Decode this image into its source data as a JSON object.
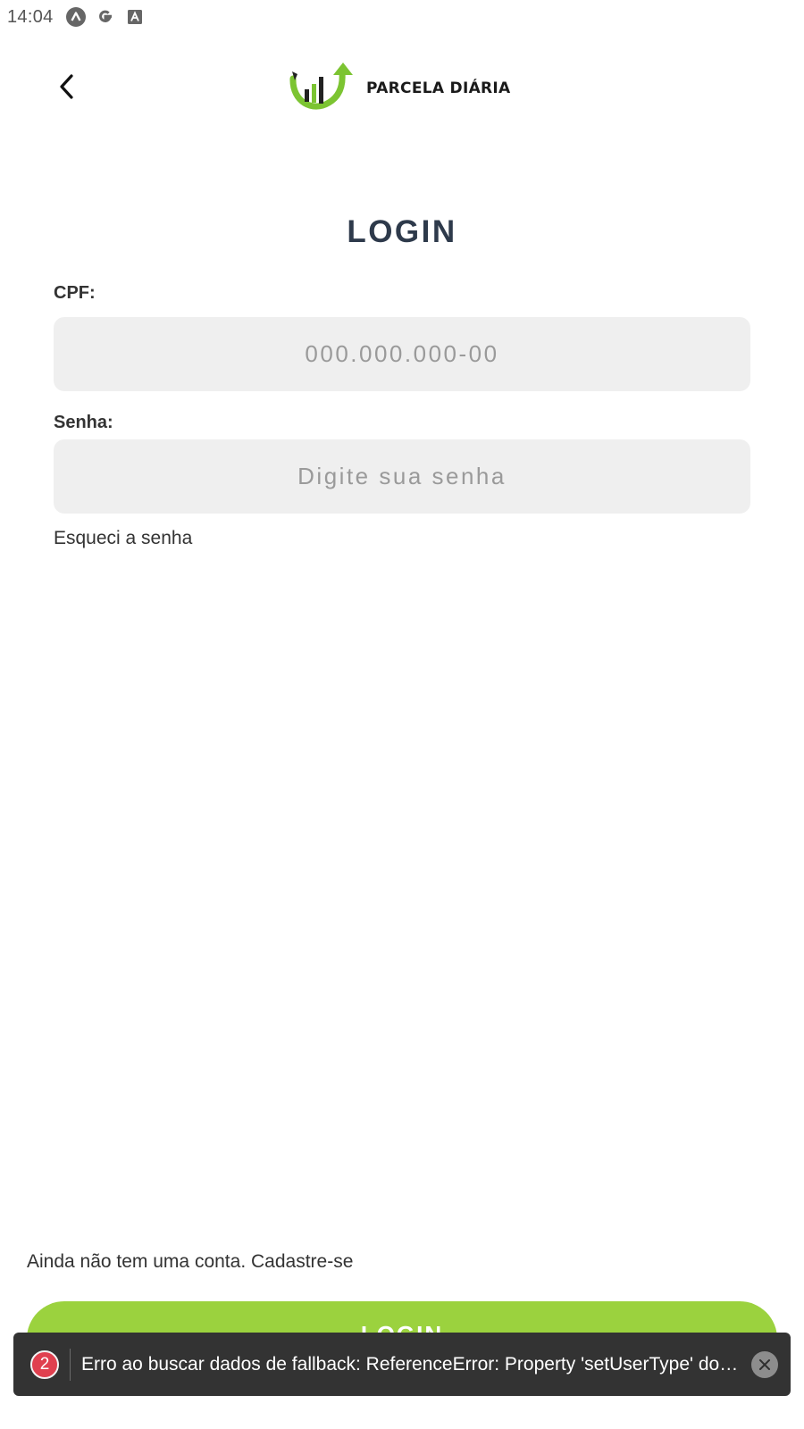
{
  "status_bar": {
    "time": "14:04",
    "icons": [
      "a-logo-icon",
      "google-icon",
      "text-box-icon"
    ]
  },
  "header": {
    "back_icon": "chevron-left-icon",
    "logo_text": "PARCELA DIÁRIA"
  },
  "title": "LOGIN",
  "form": {
    "cpf_label": "CPF:",
    "cpf_placeholder": "000.000.000-00",
    "cpf_value": "",
    "password_label": "Senha:",
    "password_placeholder": "Digite sua senha",
    "password_value": "",
    "forgot_password": "Esqueci a senha"
  },
  "signup_text": "Ainda não tem uma conta. Cadastre-se",
  "login_button": "LOGIN",
  "toast": {
    "count": "2",
    "message": "Erro ao buscar dados de fallback: ReferenceError: Property 'setUserType' doesn't exist",
    "close_icon": "close-icon"
  },
  "colors": {
    "accent_green": "#9bd23e",
    "title_color": "#2e3a4b",
    "input_bg": "#efefef",
    "toast_bg": "#333333",
    "badge_red": "#e0404f"
  }
}
